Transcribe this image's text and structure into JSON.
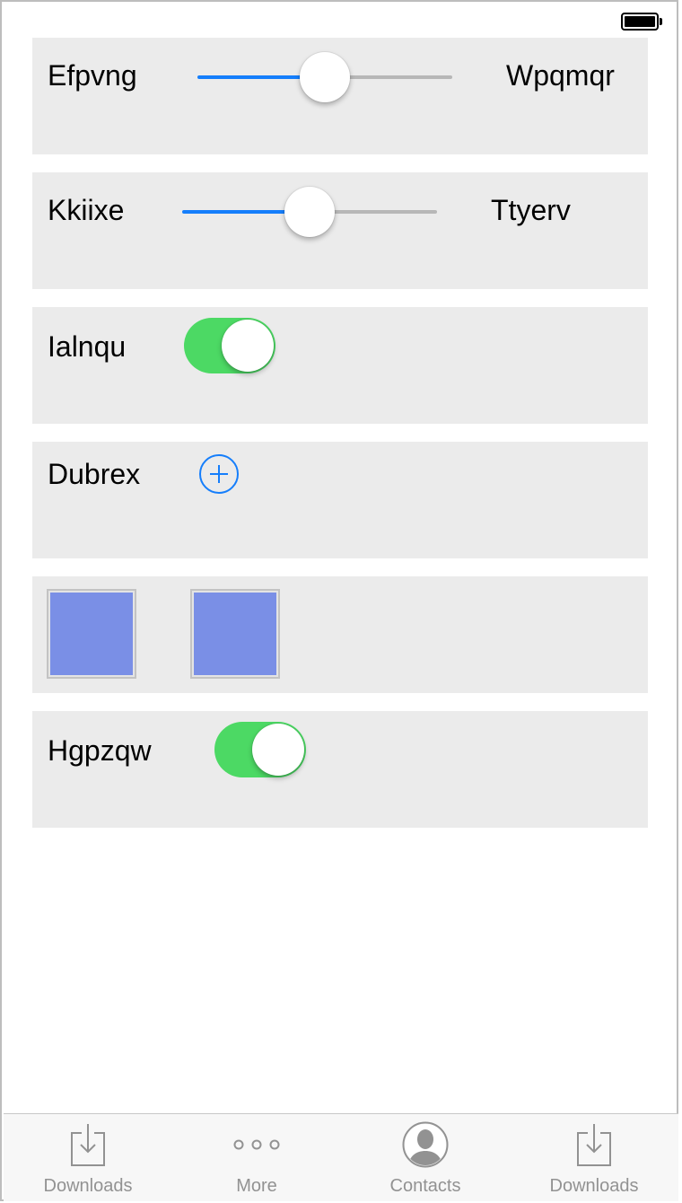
{
  "status_bar": {
    "battery_level": 1.0
  },
  "rows": [
    {
      "type": "slider",
      "label": "Efpvng",
      "max_label": "Wpqmqr",
      "value": 0.5
    },
    {
      "type": "slider",
      "label": "Kkiixe",
      "max_label": "Ttyerv",
      "value": 0.5
    },
    {
      "type": "toggle",
      "label": "Ialnqu",
      "on": true
    },
    {
      "type": "add",
      "label": "Dubrex"
    },
    {
      "type": "swatches",
      "colors": [
        "#7a8fe6",
        "#7a8fe6"
      ]
    },
    {
      "type": "toggle",
      "label": "Hgpzqw",
      "on": true
    }
  ],
  "colors": {
    "accent": "#157efb",
    "toggle_on": "#4cd964",
    "card_background": "#ebebeb",
    "swatch": "#7a8fe6",
    "tab_inactive": "#929292"
  },
  "tabbar": {
    "tabs": [
      {
        "label": "Downloads",
        "icon": "download-icon"
      },
      {
        "label": "More",
        "icon": "more-icon"
      },
      {
        "label": "Contacts",
        "icon": "contacts-icon"
      },
      {
        "label": "Downloads",
        "icon": "download-icon"
      }
    ]
  }
}
